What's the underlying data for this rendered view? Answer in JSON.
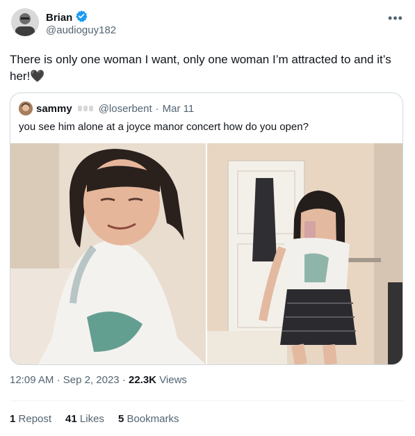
{
  "author": {
    "name": "Brian",
    "handle": "@audioguy182",
    "verified": true
  },
  "tweet_text": "There is only one woman I want, only one woman I’m attracted to and it’s her!",
  "tweet_emoji": "🖤",
  "quote": {
    "name": "sammy",
    "handle": "@loserbent",
    "separator": "·",
    "date": "Mar 11",
    "text": "you see him alone at a joyce manor concert how do you open?"
  },
  "meta": {
    "time": "12:09 AM",
    "separator": "·",
    "date": "Sep 2, 2023",
    "views_count": "22.3K",
    "views_label": "Views"
  },
  "stats": {
    "reposts_count": "1",
    "reposts_label": "Repost",
    "likes_count": "41",
    "likes_label": "Likes",
    "bookmarks_count": "5",
    "bookmarks_label": "Bookmarks"
  },
  "colors": {
    "verified_badge": "#1d9bf0",
    "secondary_text": "#536471",
    "border": "#cfd9de"
  },
  "icons": [
    "verified-badge-icon",
    "more-options-icon"
  ]
}
